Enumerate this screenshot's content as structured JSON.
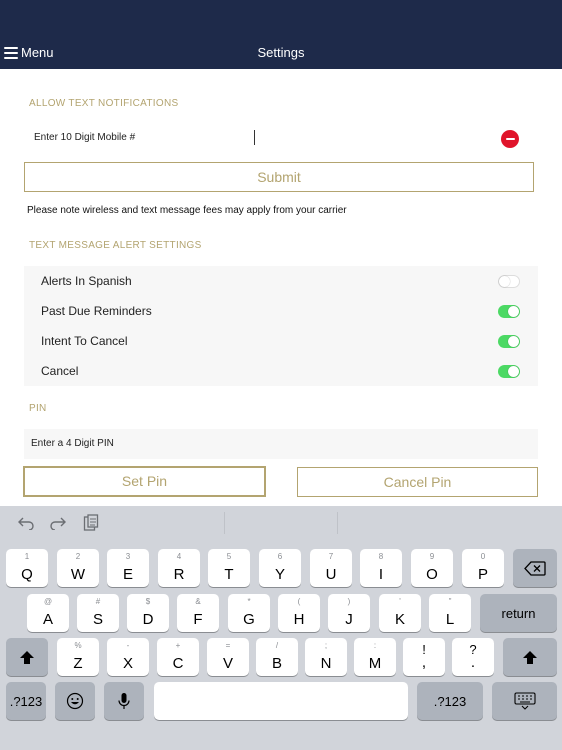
{
  "header": {
    "menu_label": "Menu",
    "title": "Settings"
  },
  "notifications": {
    "section_label": "ALLOW TEXT NOTIFICATIONS",
    "phone_placeholder": "Enter 10 Digit Mobile #",
    "submit_label": "Submit",
    "fee_note": "Please note wireless and text message fees may apply from your carrier"
  },
  "alerts": {
    "section_label": "TEXT MESSAGE ALERT SETTINGS",
    "items": [
      {
        "label": "Alerts In Spanish",
        "enabled": false
      },
      {
        "label": "Past Due Reminders",
        "enabled": true
      },
      {
        "label": "Intent To Cancel",
        "enabled": true
      },
      {
        "label": "Cancel",
        "enabled": true
      }
    ]
  },
  "pin": {
    "section_label": "PIN",
    "placeholder": "Enter a 4 Digit PIN",
    "set_label": "Set Pin",
    "cancel_label": "Cancel Pin"
  },
  "keyboard": {
    "row1": [
      {
        "main": "Q",
        "alt": "1"
      },
      {
        "main": "W",
        "alt": "2"
      },
      {
        "main": "E",
        "alt": "3"
      },
      {
        "main": "R",
        "alt": "4"
      },
      {
        "main": "T",
        "alt": "5"
      },
      {
        "main": "Y",
        "alt": "6"
      },
      {
        "main": "U",
        "alt": "7"
      },
      {
        "main": "I",
        "alt": "8"
      },
      {
        "main": "O",
        "alt": "9"
      },
      {
        "main": "P",
        "alt": "0"
      }
    ],
    "row2": [
      {
        "main": "A",
        "alt": "@"
      },
      {
        "main": "S",
        "alt": "#"
      },
      {
        "main": "D",
        "alt": "$"
      },
      {
        "main": "F",
        "alt": "&"
      },
      {
        "main": "G",
        "alt": "*"
      },
      {
        "main": "H",
        "alt": "("
      },
      {
        "main": "J",
        "alt": ")"
      },
      {
        "main": "K",
        "alt": "'"
      },
      {
        "main": "L",
        "alt": "\""
      }
    ],
    "row3": [
      {
        "main": "Z",
        "alt": "%"
      },
      {
        "main": "X",
        "alt": "-"
      },
      {
        "main": "C",
        "alt": "+"
      },
      {
        "main": "V",
        "alt": "="
      },
      {
        "main": "B",
        "alt": "/"
      },
      {
        "main": "N",
        "alt": ";"
      },
      {
        "main": "M",
        "alt": ":"
      },
      {
        "main": ",",
        "alt": "!"
      },
      {
        "main": ".",
        "alt": "?"
      }
    ],
    "return_label": "return",
    "numbers_label": ".?123"
  }
}
